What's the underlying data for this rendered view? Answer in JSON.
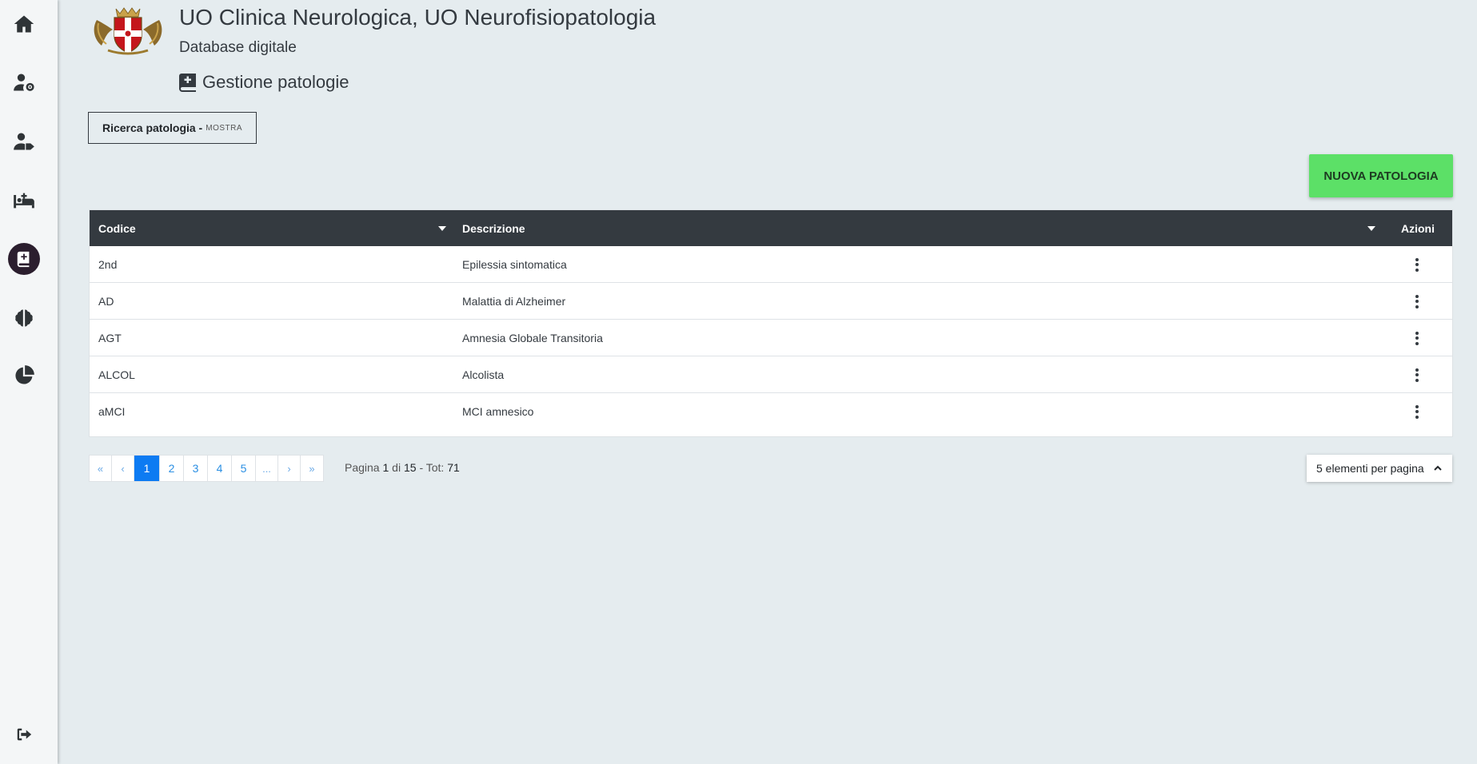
{
  "header": {
    "title": "UO Clinica Neurologica, UO Neurofisiopatologia",
    "subtitle": "Database digitale",
    "section": "Gestione patologie"
  },
  "sidebar": {
    "items": [
      {
        "icon": "home-icon"
      },
      {
        "icon": "user-settings-icon"
      },
      {
        "icon": "user-tag-icon"
      },
      {
        "icon": "hospital-bed-icon"
      },
      {
        "icon": "medical-book-icon",
        "active": true
      },
      {
        "icon": "brain-icon"
      },
      {
        "icon": "pie-chart-icon"
      },
      {
        "icon": "logout-icon"
      }
    ],
    "active_color": "#2b1e2e"
  },
  "search": {
    "label": "Ricerca patologia -",
    "toggle": "MOSTRA"
  },
  "new_button": {
    "label": "NUOVA PATOLOGIA",
    "color": "#5ce067"
  },
  "table": {
    "columns": [
      "Codice",
      "Descrizione",
      "Azioni"
    ],
    "rows": [
      {
        "code": "2nd",
        "description": "Epilessia sintomatica"
      },
      {
        "code": "AD",
        "description": "Malattia di Alzheimer"
      },
      {
        "code": "AGT",
        "description": "Amnesia Globale Transitoria"
      },
      {
        "code": "ALCOL",
        "description": "Alcolista"
      },
      {
        "code": "aMCI",
        "description": "MCI amnesico"
      }
    ]
  },
  "pagination": {
    "first": "«",
    "prev": "‹",
    "pages": [
      "1",
      "2",
      "3",
      "4",
      "5"
    ],
    "ellipsis": "...",
    "next": "›",
    "last": "»",
    "current": "1",
    "info": {
      "pagina_label": "Pagina",
      "current": "1",
      "di_label": "di",
      "total_pages": "15",
      "tot_label": "- Tot:",
      "total": "71"
    },
    "per_page": "5 elementi per pagina"
  }
}
